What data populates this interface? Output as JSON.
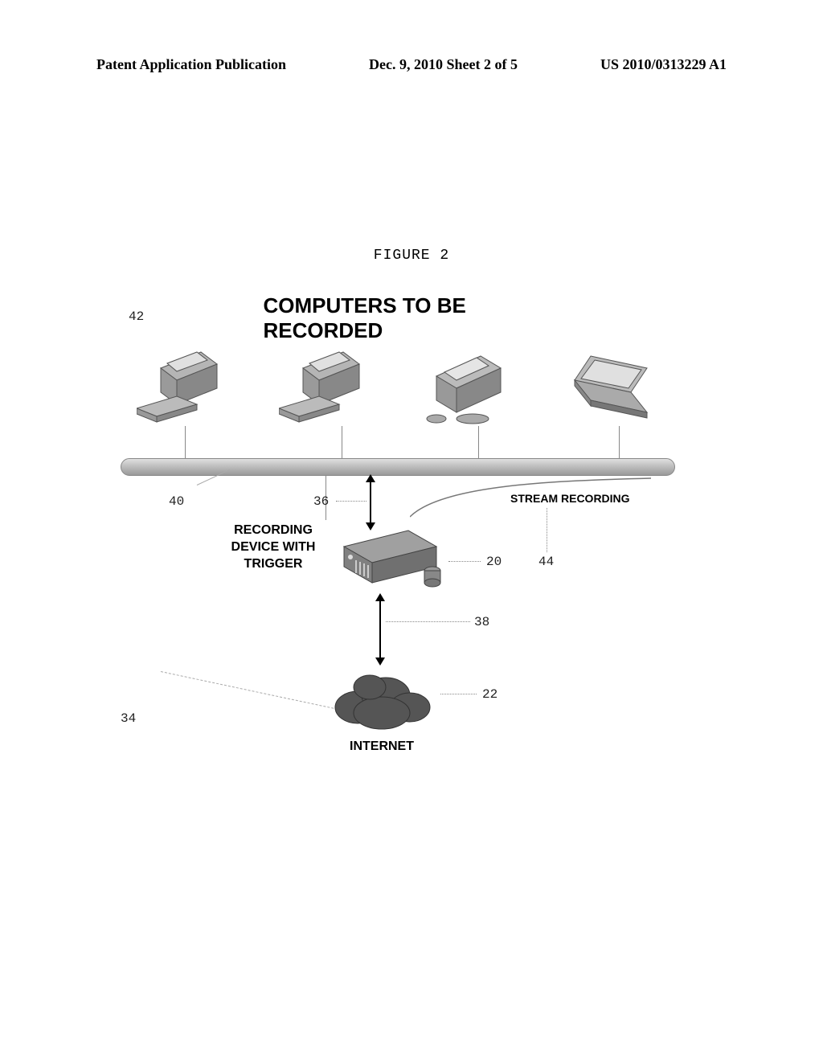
{
  "header": {
    "left": "Patent Application Publication",
    "center": "Dec. 9, 2010  Sheet 2 of 5",
    "right": "US 2010/0313229 A1"
  },
  "figure_label": "FIGURE 2",
  "title": "COMPUTERS TO BE RECORDED",
  "labels": {
    "recording_device": "RECORDING DEVICE WITH TRIGGER",
    "stream_recording": "STREAM RECORDING",
    "internet": "INTERNET"
  },
  "refs": {
    "r42": "42",
    "r40": "40",
    "r36": "36",
    "r44": "44",
    "r20": "20",
    "r38": "38",
    "r34": "34",
    "r22": "22"
  }
}
